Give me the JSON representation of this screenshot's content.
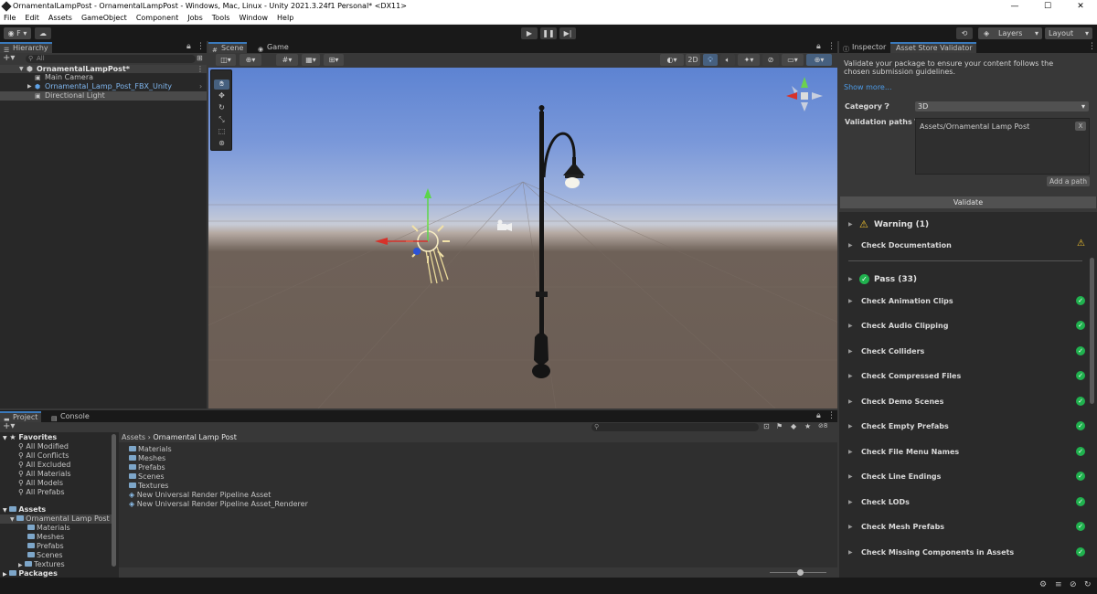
{
  "window": {
    "title": "OrnamentalLampPost - OrnamentalLampPost - Windows, Mac, Linux - Unity 2021.3.24f1 Personal* <DX11>",
    "controls": [
      "—",
      "☐",
      "✕"
    ]
  },
  "menu": [
    "File",
    "Edit",
    "Assets",
    "GameObject",
    "Component",
    "Jobs",
    "Tools",
    "Window",
    "Help"
  ],
  "toolbar": {
    "account_label": "F",
    "layers_label": "Layers",
    "layout_label": "Layout"
  },
  "hierarchy": {
    "tab_label": "Hierarchy",
    "search_placeholder": "All",
    "items": [
      {
        "label": "OrnamentalLampPost*"
      },
      {
        "label": "Main Camera"
      },
      {
        "label": "Ornamental_Lamp_Post_FBX_Unity"
      },
      {
        "label": "Directional Light"
      }
    ]
  },
  "scene": {
    "tabs": [
      {
        "label": "Scene"
      },
      {
        "label": "Game"
      }
    ],
    "mode_2d": "2D"
  },
  "inspector": {
    "tabs": [
      {
        "label": "Inspector"
      },
      {
        "label": "Asset Store Validator"
      }
    ],
    "description": "Validate your package to ensure your content follows the chosen submission guidelines.",
    "show_more": "Show more...",
    "category_label": "Category",
    "category_value": "3D",
    "validation_paths_label": "Validation paths",
    "validation_path": "Assets/Ornamental Lamp Post",
    "remove_path": "X",
    "add_path": "Add a path",
    "validate_button": "Validate",
    "warning_header": "Warning (1)",
    "warning_items": [
      {
        "label": "Check Documentation"
      }
    ],
    "pass_header": "Pass (33)",
    "pass_items": [
      {
        "label": "Check Animation Clips"
      },
      {
        "label": "Check Audio Clipping"
      },
      {
        "label": "Check Colliders"
      },
      {
        "label": "Check Compressed Files"
      },
      {
        "label": "Check Demo Scenes"
      },
      {
        "label": "Check Empty Prefabs"
      },
      {
        "label": "Check File Menu Names"
      },
      {
        "label": "Check Line Endings"
      },
      {
        "label": "Check LODs"
      },
      {
        "label": "Check Mesh Prefabs"
      },
      {
        "label": "Check Missing Components in Assets"
      }
    ]
  },
  "project": {
    "tabs": [
      {
        "label": "Project"
      },
      {
        "label": "Console"
      }
    ],
    "hidden_count": "8",
    "favorites_label": "Favorites",
    "favorites": [
      {
        "label": "All Modified"
      },
      {
        "label": "All Conflicts"
      },
      {
        "label": "All Excluded"
      },
      {
        "label": "All Materials"
      },
      {
        "label": "All Models"
      },
      {
        "label": "All Prefabs"
      }
    ],
    "assets_label": "Assets",
    "asset_tree": [
      {
        "label": "Ornamental Lamp Post"
      },
      {
        "label": "Materials"
      },
      {
        "label": "Meshes"
      },
      {
        "label": "Prefabs"
      },
      {
        "label": "Scenes"
      },
      {
        "label": "Textures"
      }
    ],
    "packages_label": "Packages",
    "breadcrumb": [
      "Assets",
      "Ornamental Lamp Post"
    ],
    "contents": [
      {
        "label": "Materials"
      },
      {
        "label": "Meshes"
      },
      {
        "label": "Prefabs"
      },
      {
        "label": "Scenes"
      },
      {
        "label": "Textures"
      },
      {
        "label": "New Universal Render Pipeline Asset"
      },
      {
        "label": "New Universal Render Pipeline Asset_Renderer"
      }
    ]
  },
  "colors": {
    "accent": "#3a79bb",
    "pass": "#20b14e",
    "warning": "#f4c430"
  }
}
